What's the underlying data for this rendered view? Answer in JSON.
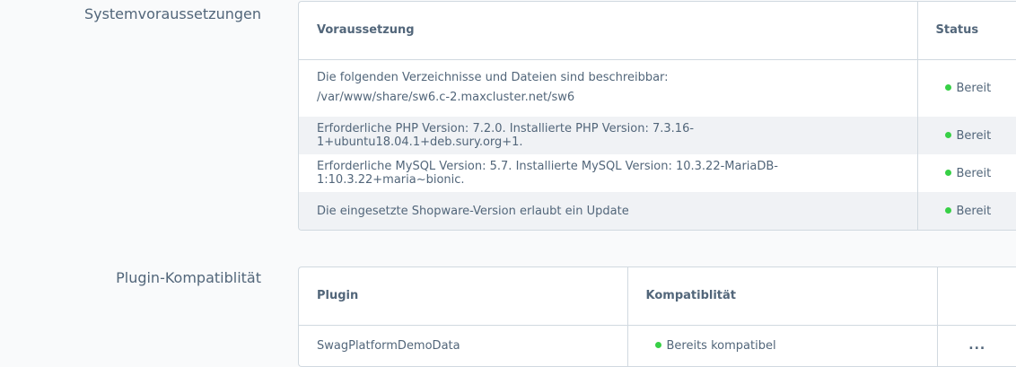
{
  "requirements": {
    "section_label": "Systemvoraussetzungen",
    "headers": {
      "requirement": "Voraussetzung",
      "status": "Status"
    },
    "rows": [
      {
        "line1": "Die folgenden Verzeichnisse und Dateien sind beschreibbar:",
        "line2": "/var/www/share/sw6.c-2.maxcluster.net/sw6",
        "status": "Bereit"
      },
      {
        "text": "Erforderliche PHP Version: 7.2.0. Installierte PHP Version: 7.3.16-1+ubuntu18.04.1+deb.sury.org+1.",
        "status": "Bereit"
      },
      {
        "text": "Erforderliche MySQL Version: 5.7. Installierte MySQL Version: 10.3.22-MariaDB-1:10.3.22+maria~bionic.",
        "status": "Bereit"
      },
      {
        "text": "Die eingesetzte Shopware-Version erlaubt ein Update",
        "status": "Bereit"
      }
    ]
  },
  "plugins": {
    "section_label": "Plugin-Kompatiblität",
    "headers": {
      "plugin": "Plugin",
      "compat": "Kompatiblität"
    },
    "rows": [
      {
        "name": "SwagPlatformDemoData",
        "compat": "Bereits kompatibel",
        "action_icon": "more-horizontal-icon",
        "action_label": "..."
      }
    ]
  },
  "colors": {
    "status_ok": "#37d046"
  }
}
